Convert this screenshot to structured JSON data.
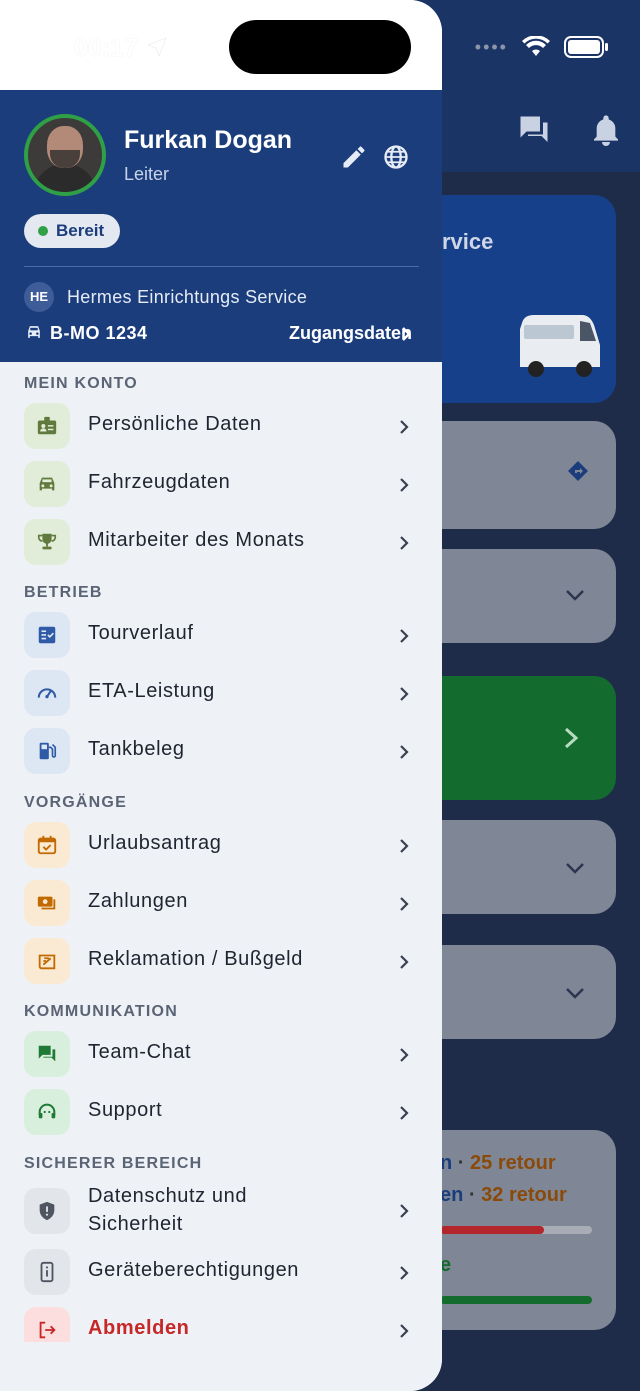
{
  "status_bar": {
    "time": "00:17"
  },
  "background": {
    "hero_text": "rvice",
    "stats": [
      {
        "left": "n",
        "value": "25 retour"
      },
      {
        "left": "en",
        "value": "32 retour"
      },
      {
        "left": "e",
        "value": ""
      }
    ]
  },
  "profile": {
    "name": "Furkan Dogan",
    "role": "Leiter",
    "status": "Bereit",
    "company_initials": "HE",
    "company": "Hermes Einrichtungs Service",
    "plate": "B-MO 1234",
    "access_link": "Zugangsdaten"
  },
  "sections": {
    "account": "MEIN KONTO",
    "operation": "BETRIEB",
    "processes": "VORGÄNGE",
    "communication": "KOMMUNIKATION",
    "secure": "SICHERER BEREICH"
  },
  "menu": {
    "personal": "Persönliche Daten",
    "vehicle": "Fahrzeugdaten",
    "employee_month": "Mitarbeiter des Monats",
    "tour_history": "Tourverlauf",
    "eta": "ETA-Leistung",
    "fuel": "Tankbeleg",
    "vacation": "Urlaubsantrag",
    "payments": "Zahlungen",
    "complaint": "Reklamation / Bußgeld",
    "team_chat": "Team-Chat",
    "support": "Support",
    "privacy_line1": "Datenschutz und",
    "privacy_line2": "Sicherheit",
    "permissions": "Geräteberechtigungen",
    "logout": "Abmelden"
  },
  "colors": {
    "header": "#1b3d7c",
    "accent_green": "#2fa046",
    "logout_red": "#c62828"
  }
}
